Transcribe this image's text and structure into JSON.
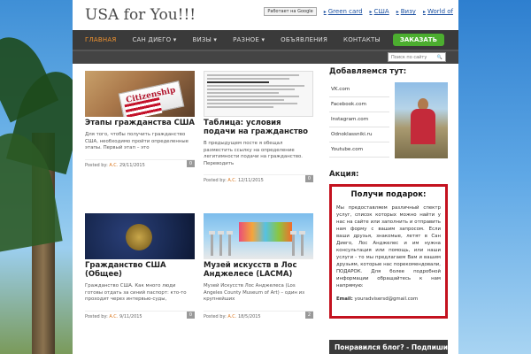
{
  "site": {
    "title": "USA for You!!!"
  },
  "top_links": {
    "translate_label": "Работает на Google",
    "items": [
      "Green card",
      "США",
      "Визу",
      "World of"
    ]
  },
  "nav": {
    "items": [
      "ГЛАВНАЯ",
      "САН ДИЕГО ▾",
      "ВИЗЫ ▾",
      "РАЗНОЕ ▾",
      "ОБЪЯВЛЕНИЯ",
      "КОНТАКТЫ"
    ],
    "order_label": "ЗАКАЗАТЬ"
  },
  "search": {
    "placeholder": "Поиск по сайту"
  },
  "posts": [
    {
      "title": "Этапы гражданства США",
      "excerpt": "Для того, чтобы получить гражданство США, необходимо пройти определенные этапы. Первый этап – это",
      "posted_by": "Posted by:",
      "author": "A.C.",
      "date": "29/11/2015",
      "comments": "0",
      "thumb_text": "Citizenship"
    },
    {
      "title": "Таблица: условия подачи на гражданство",
      "excerpt": "В предыдущем посте я обещал разместить ссылку на определение легитимности подачи на гражданство. Переводить",
      "posted_by": "Posted by:",
      "author": "A.C.",
      "date": "12/11/2015",
      "comments": "0"
    },
    {
      "title": "Гражданство США (Общее)",
      "excerpt": "Гражданство США. Как много люди готовы отдать за синий паспорт: кто-то проходит через интервью-суды,",
      "posted_by": "Posted by:",
      "author": "A.C.",
      "date": "9/11/2015",
      "comments": "0"
    },
    {
      "title": "Музей искусств в Лос Анджелесе (LACMA)",
      "excerpt": "Музей Искусств Лос Анджелеса (Los Angeles County Museum of Art) – один из крупнейших",
      "posted_by": "Posted by:",
      "author": "A.C.",
      "date": "18/5/2015",
      "comments": "2"
    }
  ],
  "sidebar": {
    "friends_title": "Добавляемся тут:",
    "friend_links": [
      "VK.com",
      "Facebook.com",
      "Instagram.com",
      "Odnoklassniki.ru",
      "Youtube.com"
    ],
    "promo_title": "Акция:",
    "promo_heading": "Получи подарок:",
    "promo_text": "Мы предоставляем различный спектр услуг, список которых можно найти у нас на сайте или заполнить и отправить нам форму с вашим запросом. Если ваши друзья, знакомые, летят в Сан Диего, Лос Анджелес и им нужна консультация или помощь, или наши услуги - то мы предлагаем Вам и вашим друзьям, которые нас порекомендовали, ПОДАРОК. Для более подробной информации обращайтесь к нам напрямую:",
    "promo_email_label": "Email:",
    "promo_email": "youradvisersd@gmail.com",
    "like_text": "Понравился блог? - Подпишись"
  }
}
